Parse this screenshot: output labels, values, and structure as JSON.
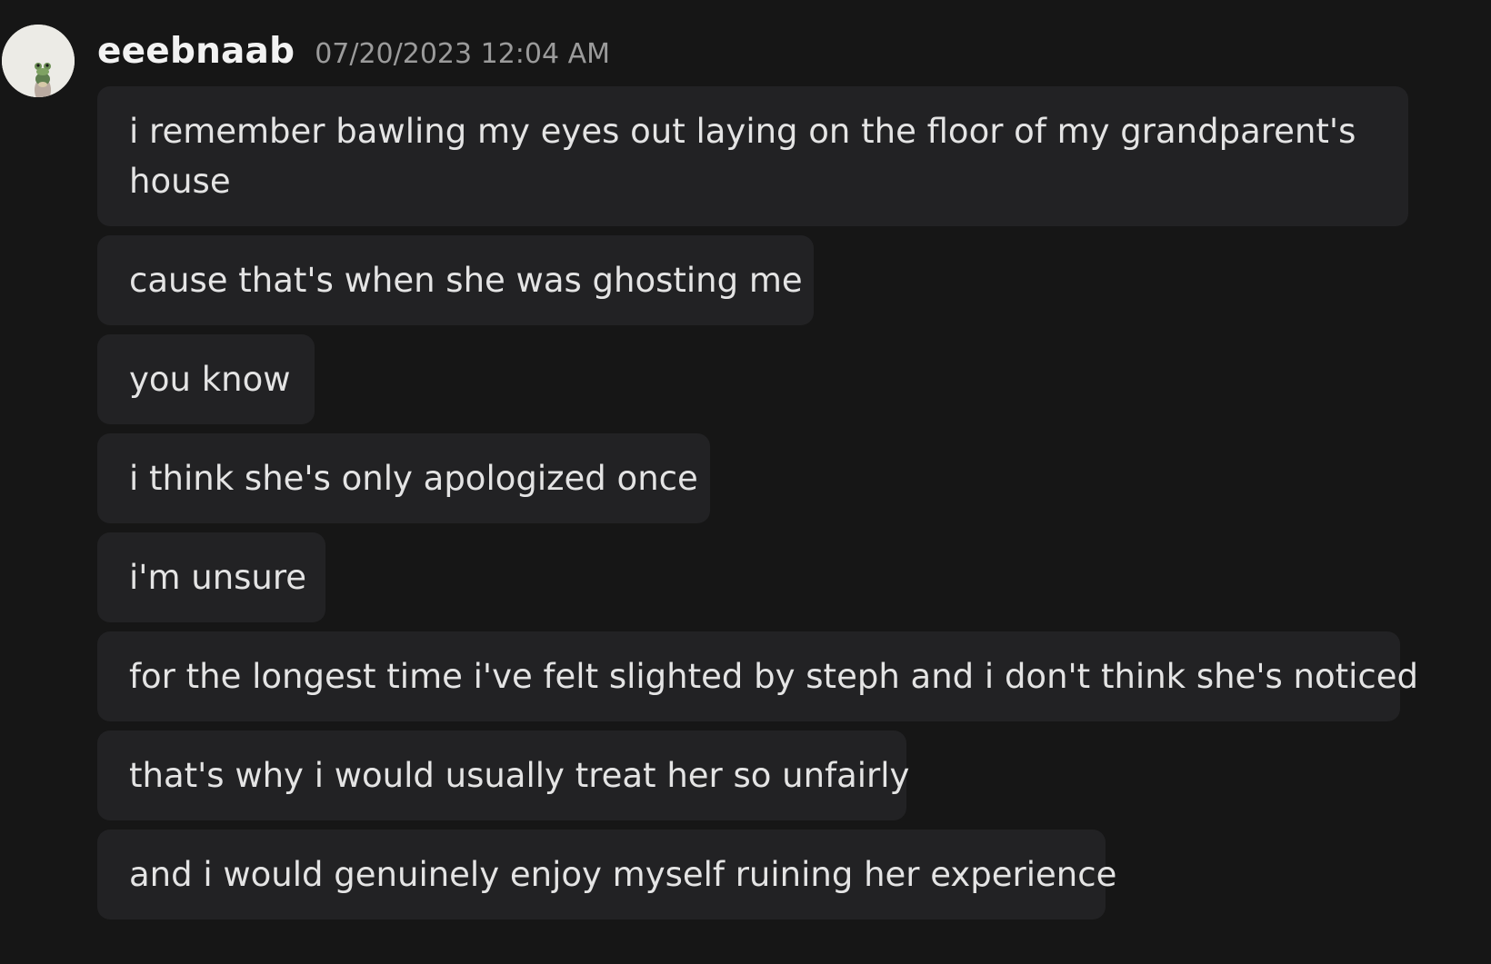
{
  "author": {
    "username": "eeebnaab",
    "timestamp": "07/20/2023 12:04 AM",
    "avatar_icon": "frog-avatar-icon"
  },
  "messages": [
    "i remember bawling my eyes out laying on the floor of my grandparent's house",
    "cause that's when she was ghosting me",
    "you know",
    "i think she's only apologized once",
    "i'm unsure",
    "for the longest time i've felt slighted by steph and i don't think she's noticed",
    "that's why i would usually treat her so unfairly",
    "and i would genuinely enjoy myself ruining her experience"
  ],
  "colors": {
    "background": "#161616",
    "bubble": "#222224",
    "username": "#f2f2f2",
    "timestamp": "#9b9b9b",
    "message_text": "#e4e4e4"
  }
}
